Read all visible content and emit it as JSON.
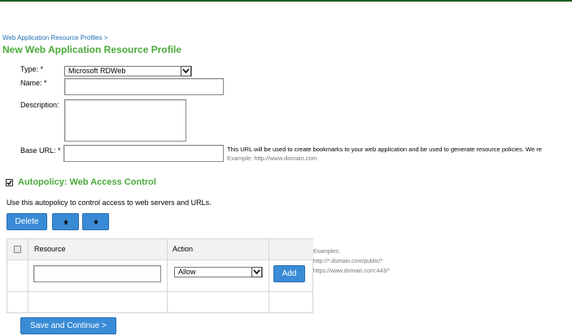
{
  "breadcrumb": {
    "link": "Web Application Resource Profiles",
    "separator": ">"
  },
  "page_title": "New Web Application Resource Profile",
  "form": {
    "type_label": "Type: *",
    "type_value": "Microsoft RDWeb",
    "name_label": "Name: *",
    "name_value": "",
    "description_label": "Description:",
    "description_value": "",
    "base_url_label": "Base URL: *",
    "base_url_value": "",
    "base_url_help": "This URL will be used to create bookmarks to your web application and be used to generate resource policies. We re",
    "base_url_example": "Example: http://www.domain.com"
  },
  "autopolicy": {
    "checked": true,
    "title": "Autopolicy: Web Access Control",
    "description": "Use this autopolicy to control access to web servers and URLs.",
    "delete_label": "Delete",
    "move_up_icon": "arrow-up-icon",
    "move_down_icon": "arrow-down-icon",
    "table": {
      "columns": [
        "Resource",
        "Action"
      ],
      "new_row": {
        "resource_value": "",
        "action_value": "Allow"
      },
      "add_label": "Add"
    },
    "examples": [
      "Examples:",
      "http://*.domain.com/public/*",
      "https://www.domain.com:443/*"
    ]
  },
  "save_label": "Save and Continue >",
  "colors": {
    "accent_green": "#4aaa3a",
    "button_blue": "#3a8bd6",
    "link_blue": "#1f6fb5"
  }
}
